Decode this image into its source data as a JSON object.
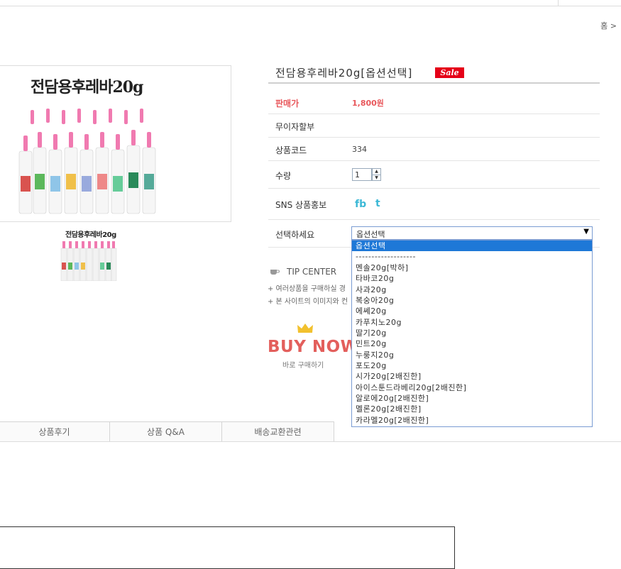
{
  "breadcrumb": "홈 >",
  "image": {
    "title": "전담용후레바20g",
    "thumb_title": "전담용후레바20g"
  },
  "product": {
    "name": "전담용후레바20g[옵션선택]",
    "badge": "Sale"
  },
  "info": {
    "price_label": "판매가",
    "price_value": "1,800원",
    "installment_label": "무이자할부",
    "code_label": "상품코드",
    "code_value": "334",
    "qty_label": "수량",
    "qty_value": "1",
    "sns_label": "SNS 상품홍보",
    "fb": "fb",
    "tw": "t",
    "option_label": "선택하세요"
  },
  "select": {
    "current": "옵션선택",
    "options": [
      "옵션선택",
      "-------------------",
      "멘솔20g[박하]",
      "타바코20g",
      "사과20g",
      "복숭아20g",
      "에쎄20g",
      "카푸치노20g",
      "딸기20g",
      "민트20g",
      "누룽지20g",
      "포도20g",
      "시가20g[2배진한]",
      "아이스툰드라베리20g[2배진한]",
      "알로에20g[2배진한]",
      "멜론20g[2배진한]",
      "카라멜20g[2배진한]"
    ],
    "selected_index": 0
  },
  "tips": {
    "header": "TIP CENTER",
    "lines": [
      "+ 여러상품을 구매하실 경",
      "+ 본 사이트의 이미지와 컨"
    ]
  },
  "buy_now": {
    "label": "BUY NOW",
    "sub": "바로 구매하기"
  },
  "tabs": [
    "상품후기",
    "상품 Q&A",
    "배송교환관련"
  ],
  "colors": {
    "accent": "#e8575b",
    "sale": "#e50018",
    "select_highlight": "#1e78d7",
    "sns": "#3bb8d6"
  }
}
